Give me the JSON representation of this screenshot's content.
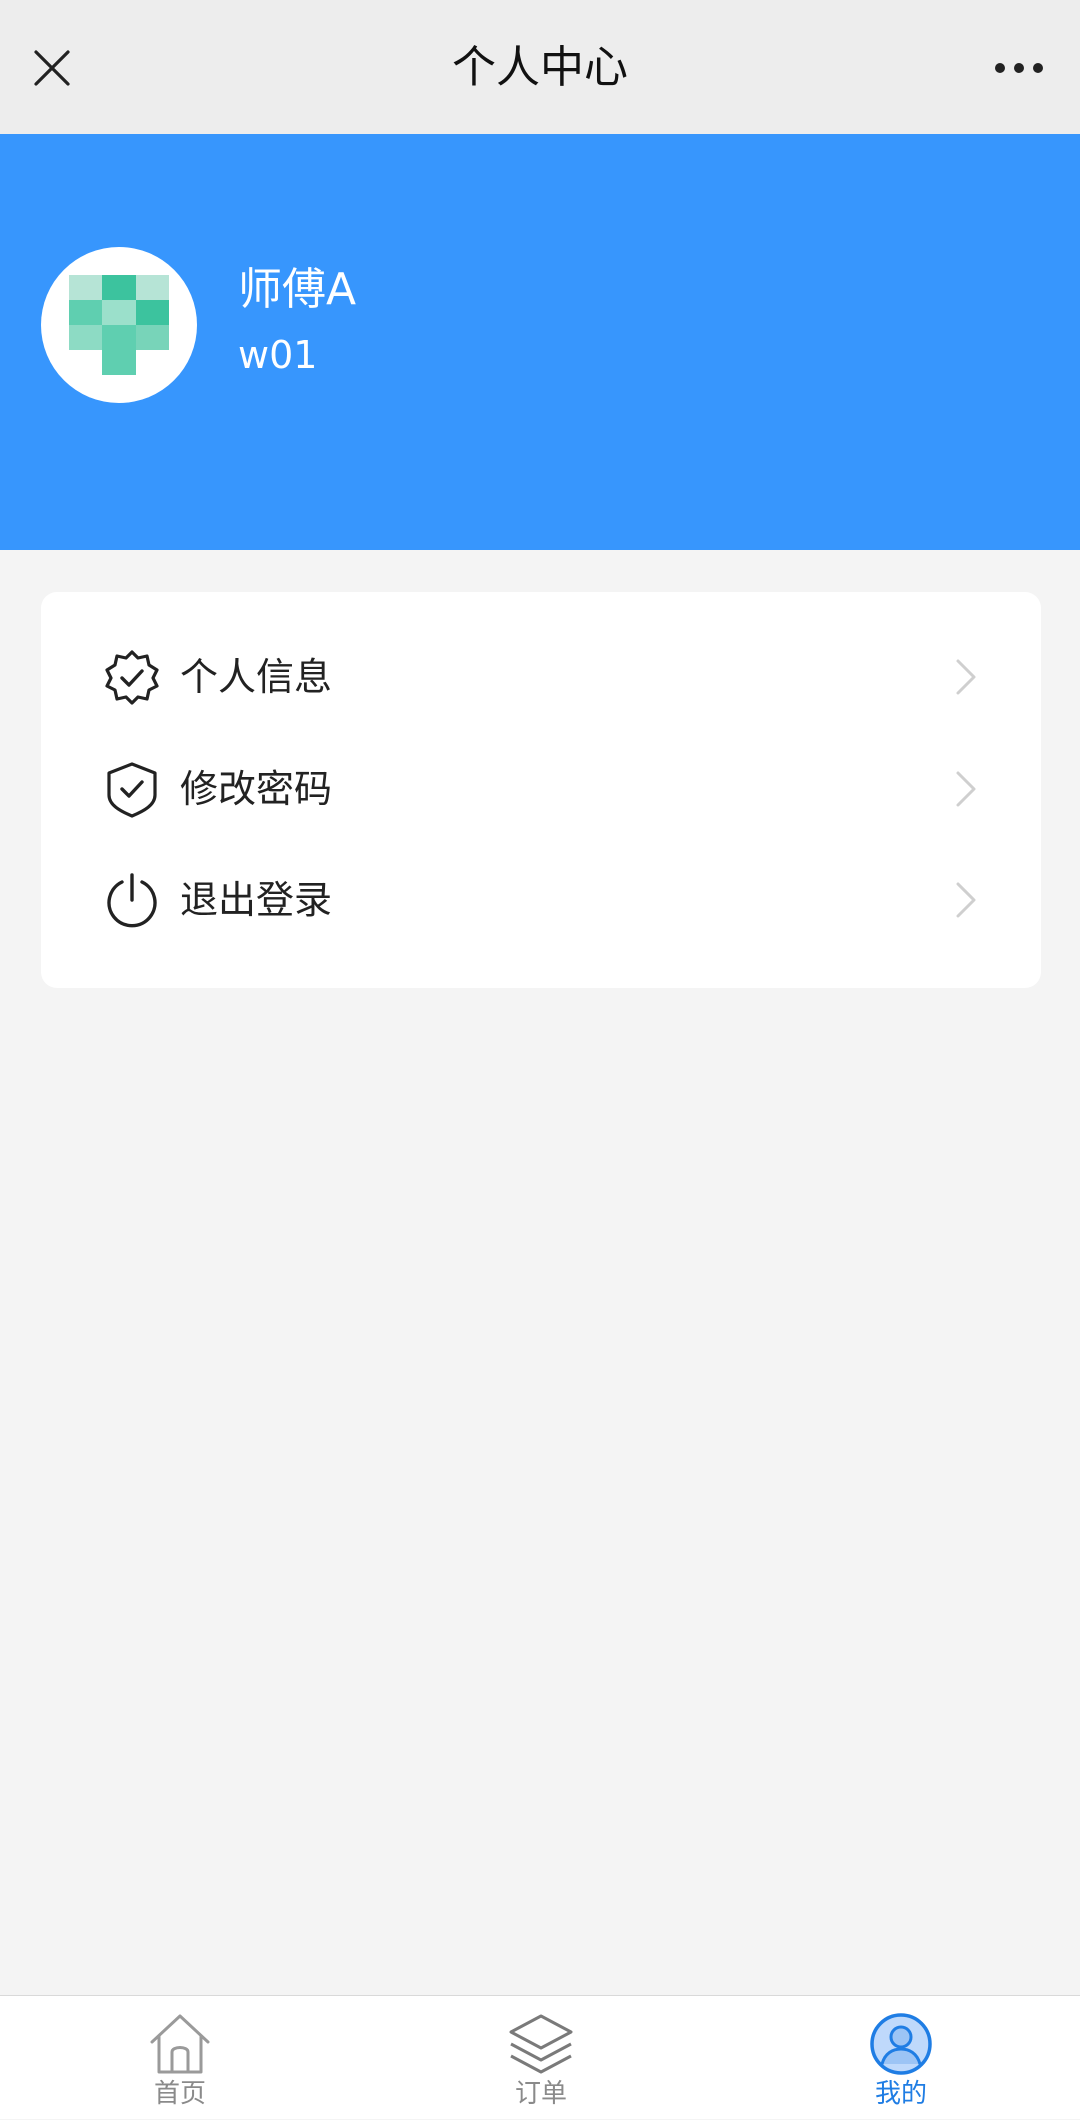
{
  "navbar": {
    "title": "个人中心",
    "close_icon": "close-icon",
    "more_icon": "more-icon"
  },
  "profile": {
    "name": "师傅A",
    "id": "w01",
    "avatar_icon": "identicon-avatar",
    "background_color": "#3796fd"
  },
  "menu": {
    "items": [
      {
        "label": "个人信息",
        "icon": "verified-badge-icon"
      },
      {
        "label": "修改密码",
        "icon": "shield-check-icon"
      },
      {
        "label": "退出登录",
        "icon": "power-icon"
      }
    ]
  },
  "tabbar": {
    "active_color": "#1f7de4",
    "tabs": [
      {
        "label": "首页",
        "icon": "home-icon",
        "active": false
      },
      {
        "label": "订单",
        "icon": "layers-icon",
        "active": false
      },
      {
        "label": "我的",
        "icon": "user-icon",
        "active": true
      }
    ]
  }
}
